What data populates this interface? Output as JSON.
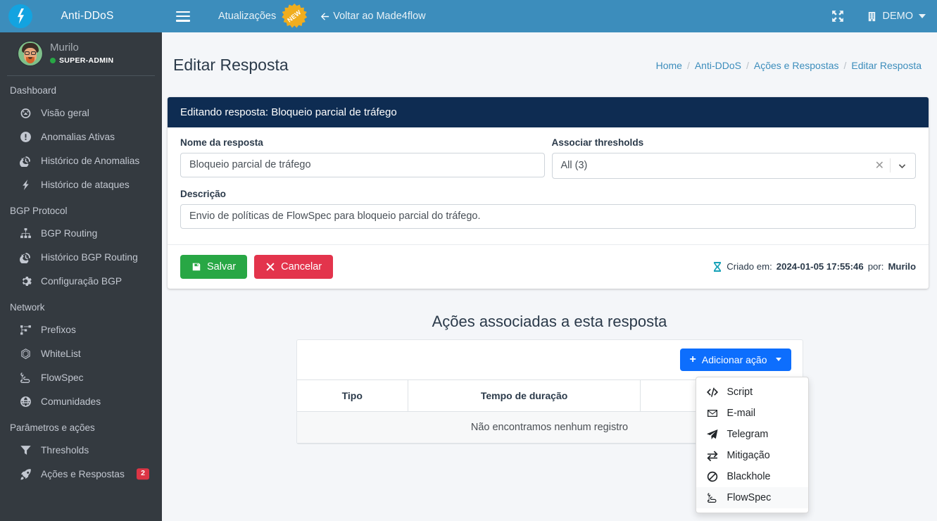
{
  "sidebar": {
    "brand": {
      "title": "Anti-DDoS",
      "logo_icon": "lightning-logo-icon"
    },
    "user": {
      "name": "Murilo",
      "role": "SUPER-ADMIN",
      "status_color": "#28a745",
      "avatar_icon": "avatar"
    },
    "groups": [
      {
        "header": "Dashboard",
        "items": [
          {
            "label": "Visão geral",
            "icon": "gauge-icon",
            "badge": ""
          },
          {
            "label": "Anomalias Ativas",
            "icon": "exclamation-circle-icon",
            "badge": ""
          },
          {
            "label": "Histórico de Anomalias",
            "icon": "history-icon",
            "badge": ""
          },
          {
            "label": "Histórico de ataques",
            "icon": "bolt-icon",
            "badge": ""
          }
        ]
      },
      {
        "header": "BGP Protocol",
        "items": [
          {
            "label": "BGP Routing",
            "icon": "sitemap-icon",
            "badge": ""
          },
          {
            "label": "Histórico BGP Routing",
            "icon": "history-icon",
            "badge": ""
          },
          {
            "label": "Configuração BGP",
            "icon": "gear-icon",
            "badge": ""
          }
        ]
      },
      {
        "header": "Network",
        "items": [
          {
            "label": "Prefixos",
            "icon": "network-nodes-icon",
            "badge": ""
          },
          {
            "label": "WhiteList",
            "icon": "hexagon-mesh-icon",
            "badge": ""
          },
          {
            "label": "FlowSpec",
            "icon": "route-icon",
            "badge": ""
          },
          {
            "label": "Comunidades",
            "icon": "globe-icon",
            "badge": ""
          }
        ]
      },
      {
        "header": "Parâmetros e ações",
        "items": [
          {
            "label": "Thresholds",
            "icon": "filter-icon",
            "badge": ""
          },
          {
            "label": "Ações e Respostas",
            "icon": "rocket-icon",
            "badge": "2"
          }
        ]
      }
    ]
  },
  "topnav": {
    "menu_toggle_icon": "hamburger-icon",
    "updates_label": "Atualizações",
    "updates_badge": "NEW",
    "back_label": "Voltar ao Made4flow",
    "back_icon": "arrow-left-icon",
    "fullscreen_icon": "expand-icon",
    "org_label": "DEMO",
    "org_icon": "building-icon",
    "accent_color": "#3c8dbc"
  },
  "page": {
    "title": "Editar Resposta",
    "breadcrumb": [
      "Home",
      "Anti-DDoS",
      "Ações e Respostas",
      "Editar Resposta"
    ]
  },
  "card": {
    "header": "Editando resposta: Bloqueio parcial de tráfego",
    "header_color": "#0e2c52",
    "fields": {
      "name_label": "Nome da resposta",
      "name_value": "Bloqueio parcial de tráfego",
      "name_placeholder": "Nome da resposta",
      "thresholds_label": "Associar thresholds",
      "thresholds_value": "All (3)",
      "description_label": "Descrição",
      "description_value": "Envio de políticas de FlowSpec para bloqueio parcial do tráfego.",
      "description_placeholder": "Descrição"
    },
    "save_label": "Salvar",
    "save_icon": "save-icon",
    "save_color": "#28a745",
    "cancel_label": "Cancelar",
    "cancel_icon": "times-icon",
    "cancel_color": "#e3344c",
    "created_prefix": "Criado em:",
    "created_date": "2024-01-05 17:55:46",
    "created_by_prefix": "por:",
    "created_by": "Murilo",
    "created_icon": "hourglass-icon"
  },
  "actions_section": {
    "title": "Ações associadas a esta resposta",
    "add_button_label": "Adicionar ação",
    "add_button_icon": "plus-icon",
    "add_button_color": "#0d6efd",
    "table": {
      "columns": [
        "Tipo",
        "Tempo de duração",
        ""
      ],
      "rows": [],
      "empty_message": "Não encontramos nenhum registro"
    },
    "dropdown": {
      "open": true,
      "items": [
        {
          "label": "Script",
          "icon": "code-icon"
        },
        {
          "label": "E-mail",
          "icon": "envelope-icon"
        },
        {
          "label": "Telegram",
          "icon": "paper-plane-icon"
        },
        {
          "label": "Mitigação",
          "icon": "exchange-icon"
        },
        {
          "label": "Blackhole",
          "icon": "ban-icon"
        },
        {
          "label": "FlowSpec",
          "icon": "route-icon"
        }
      ],
      "active_index": 5
    }
  }
}
